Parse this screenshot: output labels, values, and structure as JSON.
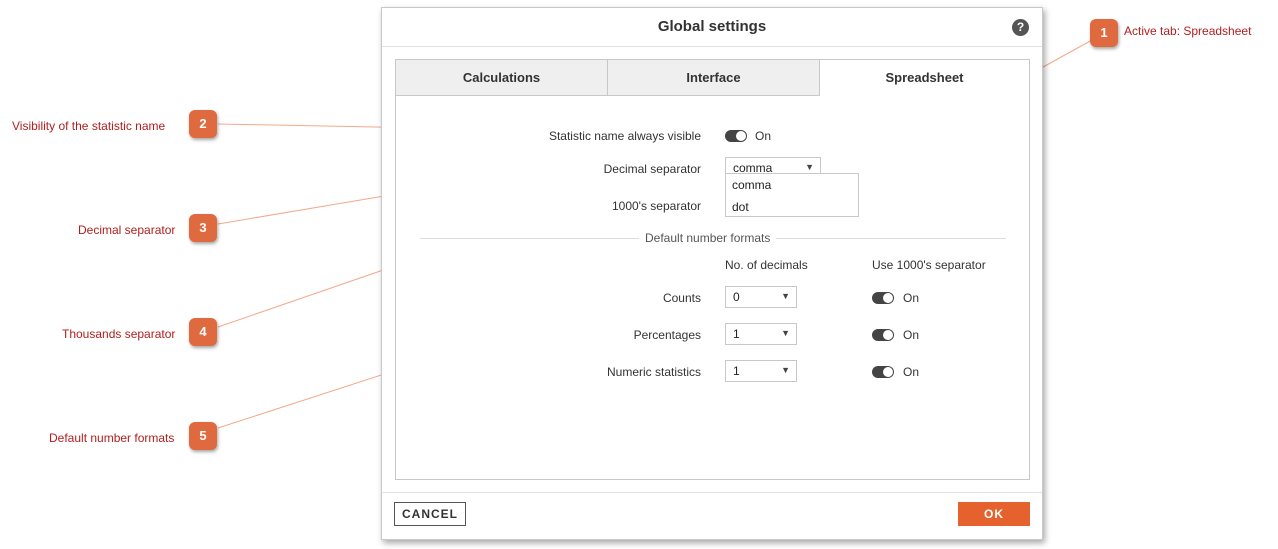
{
  "dialog": {
    "title": "Global settings",
    "help_icon": "question-icon",
    "tabs": [
      {
        "label": "Calculations"
      },
      {
        "label": "Interface"
      },
      {
        "label": "Spreadsheet"
      }
    ],
    "active_tab": "Spreadsheet",
    "statistic_name": {
      "label": "Statistic name always visible",
      "toggle_text": "On",
      "on": true
    },
    "decimal_separator": {
      "label": "Decimal separator",
      "value": "comma",
      "options": [
        "comma",
        "dot"
      ]
    },
    "thousands_separator": {
      "label": "1000's separator"
    },
    "default_formats": {
      "heading": "Default number formats",
      "col_decimals": "No. of decimals",
      "col_separator": "Use 1000's separator",
      "rows": [
        {
          "label": "Counts",
          "decimals": "0",
          "toggle_text": "On"
        },
        {
          "label": "Percentages",
          "decimals": "1",
          "toggle_text": "On"
        },
        {
          "label": "Numeric statistics",
          "decimals": "1",
          "toggle_text": "On"
        }
      ]
    },
    "buttons": {
      "cancel": "CANCEL",
      "ok": "OK"
    }
  },
  "annotations": [
    {
      "number": "1",
      "text": "Active tab: Spreadsheet"
    },
    {
      "number": "2",
      "text": "Visibility of the statistic name"
    },
    {
      "number": "3",
      "text": "Decimal separator"
    },
    {
      "number": "4",
      "text": "Thousands separator"
    },
    {
      "number": "5",
      "text": "Default number formats"
    }
  ],
  "colors": {
    "accent": "#e5622e",
    "badge": "#e06a3f",
    "note_text": "#b21e1e",
    "leader_line": "#f2a98c"
  }
}
